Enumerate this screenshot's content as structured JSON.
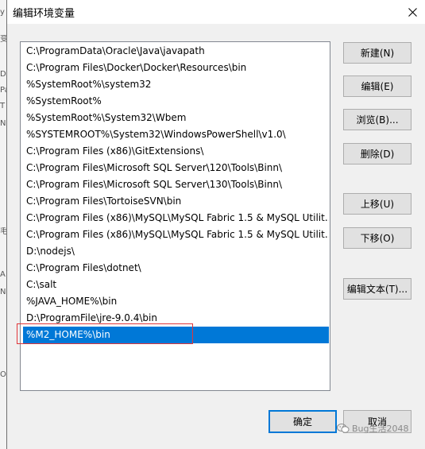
{
  "window": {
    "title": "编辑环境变量"
  },
  "paths": [
    "C:\\ProgramData\\Oracle\\Java\\javapath",
    "C:\\Program Files\\Docker\\Docker\\Resources\\bin",
    "%SystemRoot%\\system32",
    "%SystemRoot%",
    "%SystemRoot%\\System32\\Wbem",
    "%SYSTEMROOT%\\System32\\WindowsPowerShell\\v1.0\\",
    "C:\\Program Files (x86)\\GitExtensions\\",
    "C:\\Program Files\\Microsoft SQL Server\\120\\Tools\\Binn\\",
    "C:\\Program Files\\Microsoft SQL Server\\130\\Tools\\Binn\\",
    "C:\\Program Files\\TortoiseSVN\\bin",
    "C:\\Program Files (x86)\\MySQL\\MySQL Fabric 1.5 & MySQL Utilit...",
    "C:\\Program Files (x86)\\MySQL\\MySQL Fabric 1.5 & MySQL Utilit...",
    "D:\\nodejs\\",
    "C:\\Program Files\\dotnet\\",
    "C:\\salt",
    "%JAVA_HOME%\\bin",
    "D:\\ProgramFile\\jre-9.0.4\\bin",
    "%M2_HOME%\\bin"
  ],
  "selected_index": 17,
  "buttons": {
    "new": "新建(N)",
    "edit": "编辑(E)",
    "browse": "浏览(B)...",
    "delete": "删除(D)",
    "move_up": "上移(U)",
    "move_down": "下移(O)",
    "edit_text": "编辑文本(T)...",
    "ok": "确定",
    "cancel": "取消"
  },
  "watermark": {
    "text": "Bug生活2048"
  },
  "background_window": {
    "edge_chars": [
      "y",
      "",
      "变",
      "D",
      "Pa",
      "T",
      "N",
      "",
      "",
      "",
      "",
      "",
      "",
      "",
      "",
      "",
      "",
      "",
      "",
      "",
      "",
      "",
      "毛",
      "",
      "",
      "A",
      "N",
      "",
      "",
      "",
      "",
      "",
      "",
      "",
      "",
      "",
      "O",
      "",
      "",
      ""
    ]
  },
  "colors": {
    "selection": "#0078d7",
    "highlight_box": "#e0363a",
    "dialog_bg": "#f0f0f0"
  }
}
